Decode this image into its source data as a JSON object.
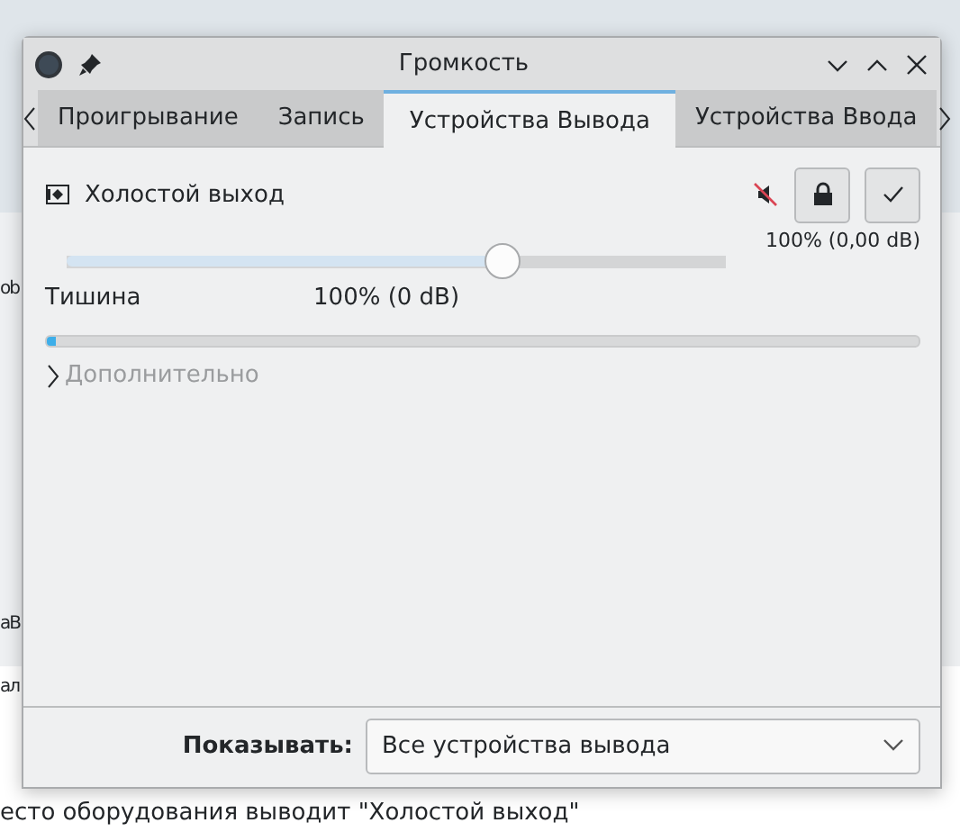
{
  "background": {
    "fragments": [
      "ob",
      "аВ",
      "ал"
    ],
    "status_text": "есто оборудования выводит \"Холостой выход\""
  },
  "window": {
    "title": "Громкость"
  },
  "tabs": [
    {
      "label": "Проигрывание",
      "selected": false
    },
    {
      "label": "Запись",
      "selected": false
    },
    {
      "label": "Устройства Вывода",
      "selected": true
    },
    {
      "label": "Устройства Ввода",
      "selected": false
    }
  ],
  "device": {
    "name": "Холостой выход",
    "muted": true,
    "reading": "100% (0,00 dB)",
    "volume": {
      "level": 0.66
    },
    "min_label": "Тишина",
    "mark_label": "100% (0 dB)",
    "peak_meter": {
      "level": 0.01
    }
  },
  "advanced": {
    "label": "Дополнительно",
    "expanded": false
  },
  "footer": {
    "label": "Показывать:",
    "value": "Все устройства вывода"
  }
}
